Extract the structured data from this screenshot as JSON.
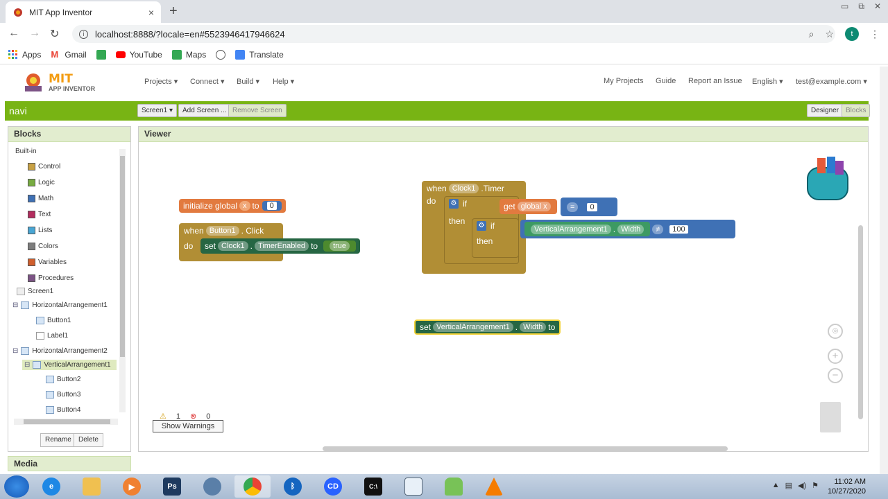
{
  "browser": {
    "tab_title": "MIT App Inventor",
    "tab_close": "×",
    "new_tab": "+",
    "url": "localhost:8888/?locale=en#5523946417946624",
    "avatar_letter": "t",
    "bookmarks": [
      "Apps",
      "Gmail",
      "YouTube",
      "Maps",
      "Translate"
    ]
  },
  "app": {
    "logo_line1": "MIT",
    "logo_line2": "APP INVENTOR",
    "menus": {
      "projects": "Projects ▾",
      "connect": "Connect ▾",
      "build": "Build ▾",
      "help": "Help ▾",
      "my_projects": "My Projects",
      "guide": "Guide",
      "report": "Report an Issue",
      "language": "English ▾",
      "account": "test@example.com ▾"
    },
    "project_name": "navi",
    "screen_select": "Screen1 ▾",
    "add_screen": "Add Screen ...",
    "remove_screen": "Remove Screen",
    "designer": "Designer",
    "blocks_btn": "Blocks"
  },
  "blocks_panel": {
    "title": "Blocks",
    "builtin": "Built-in",
    "builtin_items": [
      {
        "label": "Control",
        "color": "#c8a144"
      },
      {
        "label": "Logic",
        "color": "#77ab41"
      },
      {
        "label": "Math",
        "color": "#3f71b5"
      },
      {
        "label": "Text",
        "color": "#b32d5e"
      },
      {
        "label": "Lists",
        "color": "#49a6d4"
      },
      {
        "label": "Colors",
        "color": "#7d7d7d"
      },
      {
        "label": "Variables",
        "color": "#d05f2d"
      },
      {
        "label": "Procedures",
        "color": "#7c5385"
      }
    ],
    "components": [
      "Screen1",
      "HorizontalArrangement1",
      "Button1",
      "Label1",
      "HorizontalArrangement2",
      "VerticalArrangement1",
      "Button2",
      "Button3",
      "Button4"
    ],
    "rename": "Rename",
    "delete": "Delete",
    "media": "Media"
  },
  "viewer": {
    "title": "Viewer",
    "warnings_count": "1",
    "errors_count": "0",
    "show_warnings": "Show Warnings",
    "blocks": {
      "init_global": "initialize global",
      "var_x": "x",
      "to": "to",
      "zero": "0",
      "when": "when",
      "button1": "Button1",
      "click": ". Click",
      "do": "do",
      "set": "set",
      "clock1": "Clock1",
      "timer_enabled": "TimerEnabled",
      "true_val": "true",
      "timer": ".Timer",
      "if": "if",
      "then": "then",
      "get": "get",
      "global_x": "global x",
      "eq": "=",
      "va1": "VerticalArrangement1",
      "width": "Width",
      "neq": "≠",
      "hundred": "100",
      "dot": "."
    }
  },
  "taskbar": {
    "time": "11:02 AM",
    "date": "10/27/2020",
    "cd_label": "CD"
  }
}
